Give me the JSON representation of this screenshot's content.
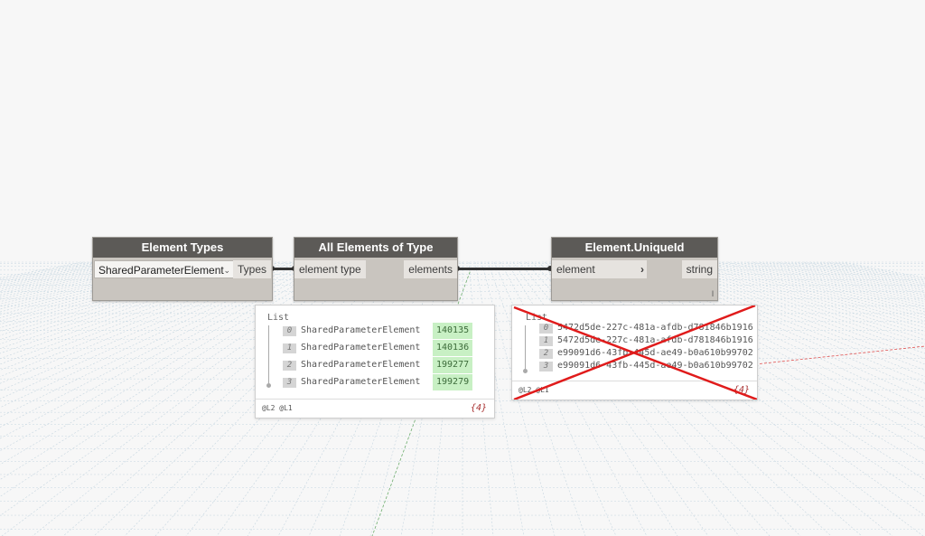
{
  "nodes": {
    "element_types": {
      "title": "Element Types",
      "dropdown_value": "SharedParameterElement",
      "output_port": "Types"
    },
    "all_elements_of_type": {
      "title": "All Elements of Type",
      "input_port": "element type",
      "output_port": "elements"
    },
    "element_uniqueid": {
      "title": "Element.UniqueId",
      "input_port": "element",
      "output_port": "string",
      "lacing": "l"
    }
  },
  "previews": {
    "elements": {
      "list_label": "List",
      "rows": [
        {
          "index": "0",
          "name": "SharedParameterElement",
          "value": "140135"
        },
        {
          "index": "1",
          "name": "SharedParameterElement",
          "value": "140136"
        },
        {
          "index": "2",
          "name": "SharedParameterElement",
          "value": "199277"
        },
        {
          "index": "3",
          "name": "SharedParameterElement",
          "value": "199279"
        }
      ],
      "levels": "@L2 @L1",
      "count": "{4}"
    },
    "unique_ids": {
      "list_label": "List",
      "rows": [
        {
          "index": "0",
          "value": "5472d5de-227c-481a-afdb-d781846b1916"
        },
        {
          "index": "1",
          "value": "5472d5de-227c-481a-afdb-d781846b1916"
        },
        {
          "index": "2",
          "value": "e99091d6-43fb-445d-ae49-b0a610b99702"
        },
        {
          "index": "3",
          "value": "e99091d6-43fb-445d-ae49-b0a610b99702"
        }
      ],
      "levels": "@L2 @L1",
      "count": "{4}"
    }
  },
  "colors": {
    "node_header": "#5c5a57",
    "node_body": "#c9c5bf",
    "value_highlight": "#c8f0c4",
    "strike_mark": "#e01b1b"
  },
  "icons": {
    "dropdown": "chevron-down-icon",
    "input_marker": "chevron-right-icon",
    "invalid": "red-x-icon"
  }
}
